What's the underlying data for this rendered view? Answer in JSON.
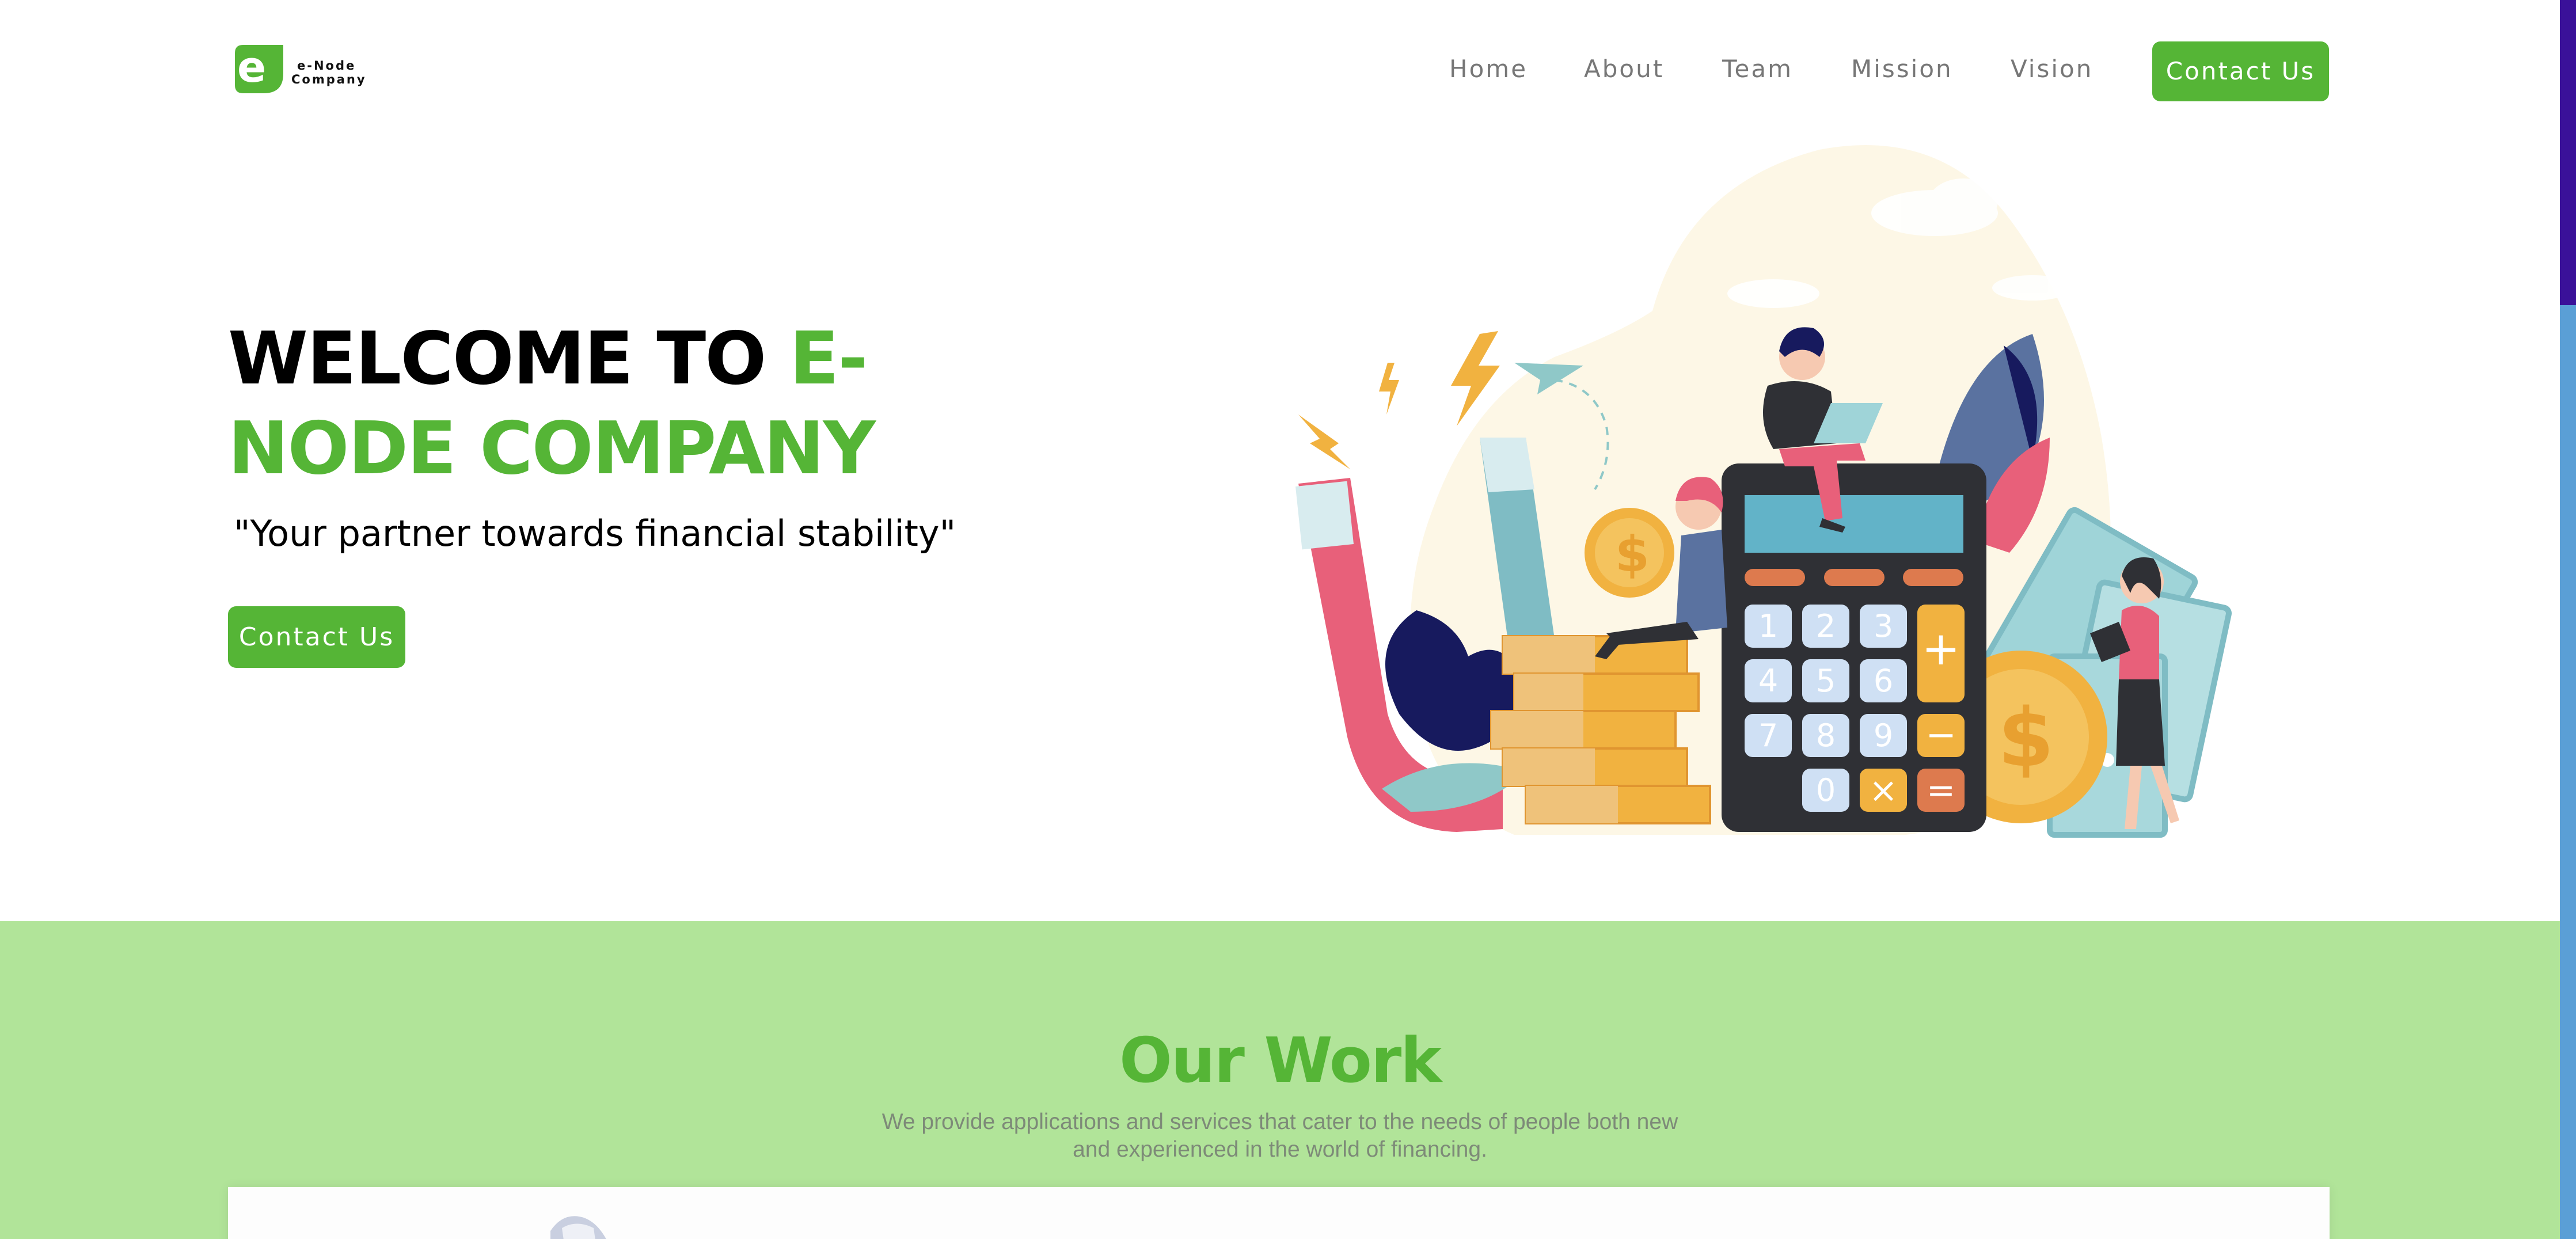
{
  "brand": {
    "logo_letter": "e",
    "name_line1": "e-Node",
    "name_line2": "Company",
    "accent_color": "#55b536",
    "section_bg_color": "#b1e499"
  },
  "nav": {
    "items": [
      {
        "label": "Home"
      },
      {
        "label": "About"
      },
      {
        "label": "Team"
      },
      {
        "label": "Mission"
      },
      {
        "label": "Vision"
      }
    ],
    "cta_label": "Contact Us"
  },
  "hero": {
    "title_part1": "WELCOME TO ",
    "title_part2": "E-NODE COMPANY",
    "tagline": "\"Your partner towards financial stability\"",
    "cta_label": "Contact Us",
    "illustration": {
      "icon": "finance-illustration",
      "calculator_keys": [
        "1",
        "2",
        "3",
        "+",
        "4",
        "5",
        "6",
        "7",
        "8",
        "9",
        "−",
        "0",
        "×",
        "="
      ]
    }
  },
  "our_work": {
    "title": "Our Work",
    "description": "We provide applications and services that cater to the needs of people both new and experienced in the world of financing."
  }
}
